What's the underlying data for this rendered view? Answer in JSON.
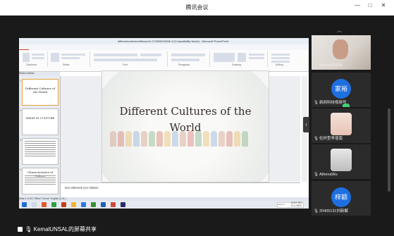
{
  "window": {
    "title": "腾讯会议",
    "controls": [
      "—",
      "□",
      "✕"
    ]
  },
  "share": {
    "ppt_title": "differentculturesoftheworld-170308023456-3 [Compatibility Mode] - Microsoft PowerPoint",
    "tabs": [
      "File",
      "Home",
      "Insert",
      "Design",
      "Transitions",
      "Animations",
      "Slide Show",
      "Review",
      "View"
    ],
    "ribbon_groups": [
      "Clipboard",
      "Slides",
      "Font",
      "Paragraph",
      "Drawing",
      "Editing"
    ],
    "pane_tabs": "Slides   Outline",
    "thumbnails": [
      {
        "num": "1",
        "text": "Different Cultures of the World"
      },
      {
        "num": "2",
        "text": "WHAT IS CULTURE"
      },
      {
        "num": "3",
        "text": ""
      },
      {
        "num": "4",
        "text": "Characteristics of Culture"
      }
    ],
    "slide_title": "Different Cultures of the World",
    "notes_placeholder": "Not eklemek için tıklatın",
    "status": "Slide 1 of 15    \"Office Theme\"    English (U.S.)",
    "taskbar_search": "Search",
    "clock_time": "10:27 ÖÖ",
    "clock_date": "11.1.2021"
  },
  "participants": [
    {
      "name": "KemalUNSAL",
      "type": "photo"
    },
    {
      "name": "新网科技视频号",
      "type": "avatar",
      "avatar_text": "家裕",
      "color": "#1e6fe0"
    },
    {
      "name": "伦杯型李增南",
      "type": "photo"
    },
    {
      "name": "AthenaWu",
      "type": "photo"
    },
    {
      "name": "20405131刘新解",
      "type": "avatar",
      "avatar_text": "梓颖",
      "color": "#1e6fe0"
    }
  ],
  "bottom_label": "KemalUNSAL的屏幕共享",
  "icons": [
    "mic-icon",
    "screen-share-icon",
    "collapse-arrow-icon",
    "chevron-up-icon",
    "chevron-down-icon"
  ]
}
